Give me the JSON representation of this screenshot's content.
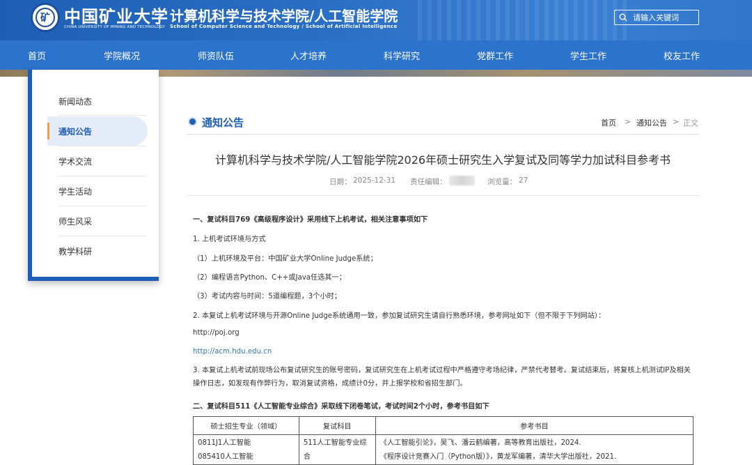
{
  "header": {
    "university_name": "中国矿业大学",
    "university_name_en": "CHINA UNIVERSITY OF MINING AND TECHNOLOGY",
    "school_name": "计算机科学与技术学院/人工智能学院",
    "school_name_en": "School of Computer Science and Technology / School of Artificial Intelligence",
    "search_placeholder": "请输入关键词"
  },
  "nav": {
    "items": [
      "首页",
      "学院概况",
      "师资队伍",
      "人才培养",
      "科学研究",
      "党群工作",
      "学生工作",
      "校友工作"
    ]
  },
  "sidebar": {
    "items": [
      {
        "label": "新闻动态"
      },
      {
        "label": "通知公告"
      },
      {
        "label": "学术交流"
      },
      {
        "label": "学生活动"
      },
      {
        "label": "师生风采"
      },
      {
        "label": "教学科研"
      }
    ],
    "active": "通知公告"
  },
  "section": {
    "title": "通知公告",
    "breadcrumb": [
      "首页",
      "通知公告",
      "正文"
    ],
    "separator": ">"
  },
  "article": {
    "title": "计算机科学与技术学院/人工智能学院2026年硕士研究生入学复试及同等学力加试科目参考书",
    "date_label": "日期：",
    "date": "2025-12-31",
    "editor_label": "责任编辑：",
    "views_label": "浏览量：",
    "views": "27",
    "heading1": "一、复试科目769《高级程序设计》采用线下上机考试，相关注意事项如下",
    "p1": "1. 上机考试环境与方式",
    "p1_1": "（1）上机环境及平台：中国矿业大学Online Judge系统；",
    "p1_2": "（2）编程语言Python、C++或Java任选其一；",
    "p1_3": "（3）考试内容与时间：5道编程题，3个小时；",
    "p2": "2. 本复试上机考试环境与开源Online Judge系统通用一致，参加复试研究生请自行熟悉环境，参考网址如下（但不限于下列网站）：",
    "url1": "http://poj.org",
    "url2": "http://acm.hdu.edu.cn",
    "p3": "3. 本复试上机考试前现场公布复试研究生的账号密码，复试研究生在上机考试过程中严格遵守考场纪律，严禁代考替考。复试结束后，将复核上机测试IP及相关操作日志，如发现有作弊行为，取消复试资格，成绩计0分，并上报学校和省招生部门。",
    "heading2": "二、复试科目511《人工智能专业综合》采取线下闭卷笔试，考试时间2个小时，参考书目如下"
  },
  "table": {
    "headers": [
      "硕士招生专业（领域）",
      "复试科目",
      "参考书目"
    ],
    "rows": [
      {
        "majors": [
          "0811J1人工智能",
          "085410人工智能"
        ],
        "subject": "511人工智能专业综合",
        "books": [
          "《人工智能引论》，吴飞、潘云鹤编著，高等教育出版社，2024.",
          "《程序设计竞赛入门（Python版）》，黄龙军编著，清华大学出版社，2021."
        ]
      }
    ]
  }
}
